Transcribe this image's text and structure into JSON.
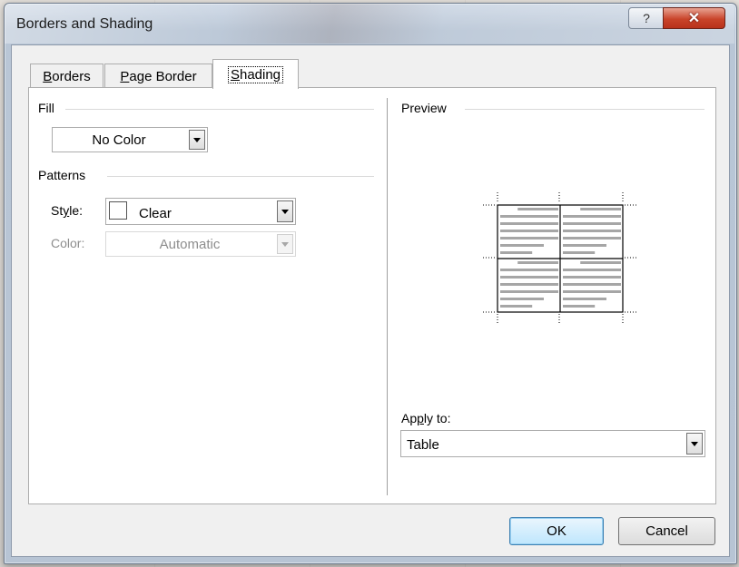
{
  "window": {
    "title": "Borders and Shading",
    "help_glyph": "?",
    "close_glyph": "✕"
  },
  "tabs": [
    {
      "label": "Borders",
      "accel": "B",
      "rest": "orders"
    },
    {
      "label": "Page Border",
      "accel": "P",
      "rest": "age Border"
    },
    {
      "label": "Shading",
      "accel": "S",
      "rest": "hading",
      "active": true
    }
  ],
  "fill": {
    "heading": "Fill",
    "value": "No Color"
  },
  "patterns": {
    "heading": "Patterns",
    "style": {
      "label_pre": "St",
      "label_accel": "y",
      "label_post": "le:",
      "value": "Clear"
    },
    "color": {
      "label": "Color:",
      "value": "Automatic",
      "disabled": true
    }
  },
  "preview": {
    "heading": "Preview"
  },
  "apply_to": {
    "label_pre": "Ap",
    "label_accel": "p",
    "label_post": "ly to:",
    "value": "Table"
  },
  "buttons": {
    "ok": "OK",
    "cancel": "Cancel"
  },
  "colors": {
    "accent": "#3c7fb1",
    "close_red": "#c9442a",
    "text_lines": "#a6a6a6"
  },
  "icons": {
    "dropdown": "chevron-down-icon",
    "help": "help-icon",
    "close": "close-icon"
  }
}
